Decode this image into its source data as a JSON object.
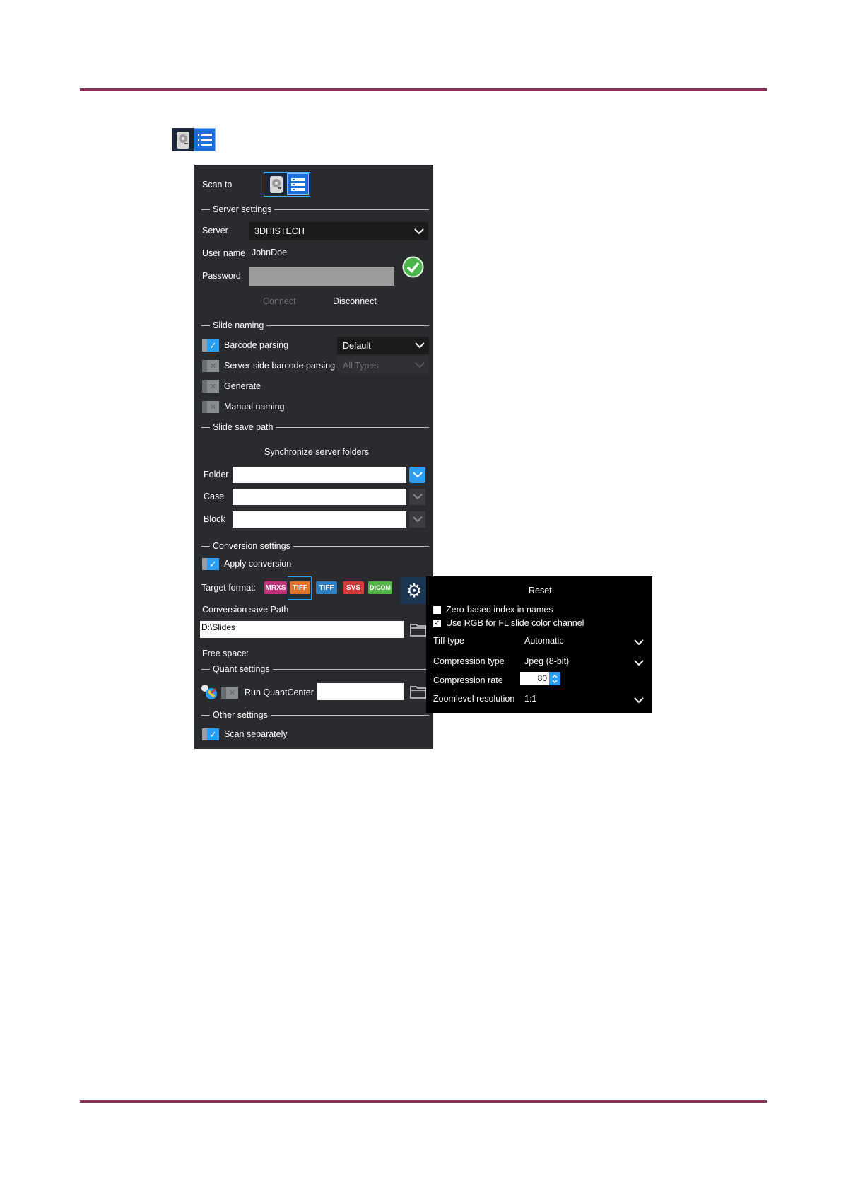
{
  "panel": {
    "scan_to_label": "Scan to",
    "sections": {
      "server_settings": "Server settings",
      "slide_naming": "Slide naming",
      "slide_save_path": "Slide save path",
      "conversion_settings": "Conversion settings",
      "quant_settings": "Quant settings",
      "other_settings": "Other settings"
    },
    "server": {
      "label": "Server",
      "value": "3DHISTECH"
    },
    "user_name": {
      "label": "User name",
      "value": "JohnDoe"
    },
    "password": {
      "label": "Password",
      "value": ""
    },
    "connect_label": "Connect",
    "disconnect_label": "Disconnect",
    "barcode_parsing": {
      "label": "Barcode parsing",
      "checked": true,
      "dropdown": "Default"
    },
    "server_side_barcode": {
      "label": "Server-side barcode parsing",
      "checked": false,
      "dropdown": "All Types"
    },
    "generate": {
      "label": "Generate",
      "checked": false
    },
    "manual_naming": {
      "label": "Manual naming",
      "checked": false
    },
    "sync_button": "Synchronize server folders",
    "folder": {
      "label": "Folder",
      "value": ""
    },
    "case": {
      "label": "Case",
      "value": ""
    },
    "block": {
      "label": "Block",
      "value": ""
    },
    "apply_conversion": {
      "label": "Apply conversion",
      "checked": true
    },
    "target_format_label": "Target format:",
    "formats": [
      {
        "label": "MRXS",
        "color": "#c2307a",
        "selected": false
      },
      {
        "label": "TIFF",
        "color": "#e0742a",
        "selected": true
      },
      {
        "label": "TIFF",
        "color": "#2f7fc4",
        "selected": false
      },
      {
        "label": "SVS",
        "color": "#d23a3a",
        "selected": false
      },
      {
        "label": "DICOM",
        "color": "#52b447",
        "selected": false
      }
    ],
    "conversion_save_path_label": "Conversion save Path",
    "conversion_save_path_value": "D:\\Slides",
    "free_space_label": "Free space:",
    "run_quantcenter": {
      "label": "Run QuantCenter",
      "checked": false,
      "value": ""
    },
    "scan_separately": {
      "label": "Scan separately",
      "checked": true
    }
  },
  "popup": {
    "reset_label": "Reset",
    "zero_based": {
      "label": "Zero-based index in names",
      "checked": false
    },
    "use_rgb": {
      "label": "Use RGB for FL slide color channel",
      "checked": true
    },
    "tiff_type": {
      "label": "Tiff type",
      "value": "Automatic"
    },
    "compression_type": {
      "label": "Compression type",
      "value": "Jpeg (8-bit)"
    },
    "compression_rate": {
      "label": "Compression rate",
      "value": "80"
    },
    "zoomlevel": {
      "label": "Zoomlevel resolution",
      "value": "1:1"
    }
  },
  "colors": {
    "accent": "#2a9df4",
    "rule": "#8a2e55",
    "panel_bg": "#2a2b2e"
  }
}
